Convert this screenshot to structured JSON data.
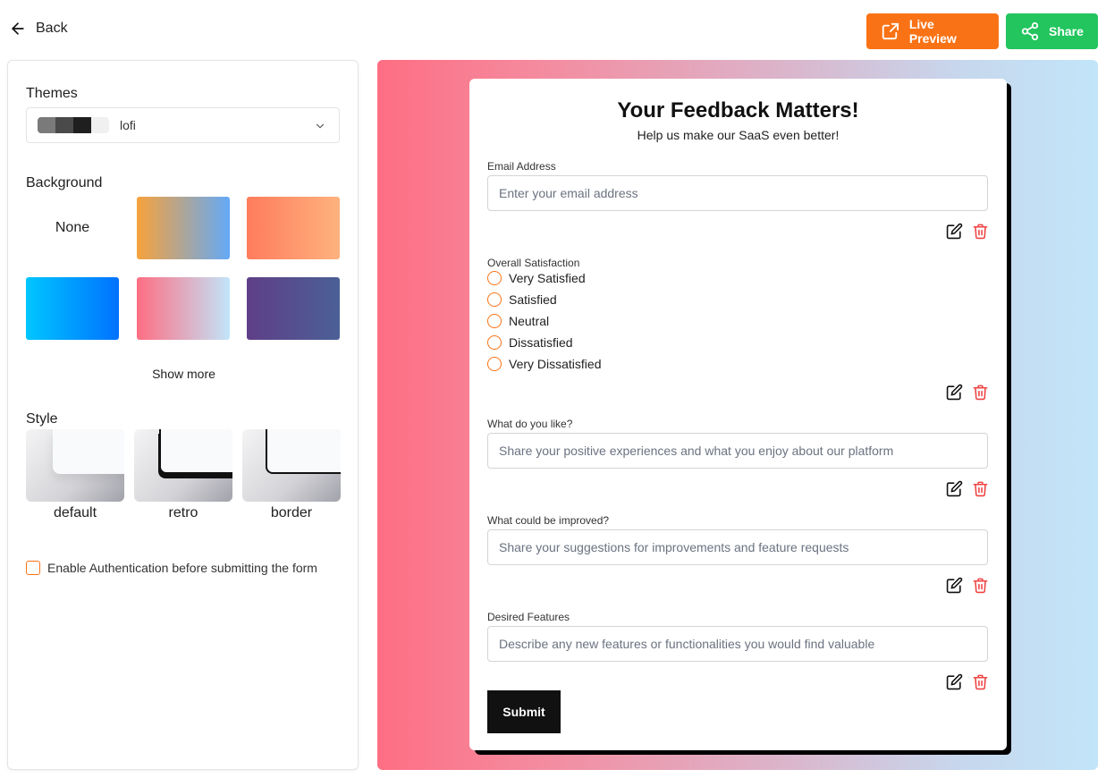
{
  "header": {
    "back_label": "Back",
    "live_preview_label": "Live Preview",
    "share_label": "Share",
    "colors": {
      "live_preview": "#f97316",
      "share": "#22c55e"
    }
  },
  "sidebar": {
    "themes_label": "Themes",
    "theme_selected": "lofi",
    "theme_swatches": [
      "#7a7a7a",
      "#4a4a4a",
      "#1f1f1f",
      "#f0f0f0"
    ],
    "background_label": "Background",
    "background_none_label": "None",
    "show_more_label": "Show more",
    "style_label": "Style",
    "styles": [
      "default",
      "retro",
      "border"
    ],
    "auth_label": "Enable Authentication before submitting the form"
  },
  "form": {
    "title": "Your Feedback Matters!",
    "subtitle": "Help us make our SaaS even better!",
    "email": {
      "label": "Email Address",
      "placeholder": "Enter your email address"
    },
    "satisfaction": {
      "label": "Overall Satisfaction",
      "options": [
        "Very Satisfied",
        "Satisfied",
        "Neutral",
        "Dissatisfied",
        "Very Dissatisfied"
      ]
    },
    "likes": {
      "label": "What do you like?",
      "placeholder": "Share your positive experiences and what you enjoy about our platform"
    },
    "improve": {
      "label": "What could be improved?",
      "placeholder": "Share your suggestions for improvements and feature requests"
    },
    "features": {
      "label": "Desired Features",
      "placeholder": "Describe any new features or functionalities you would find valuable"
    },
    "submit_label": "Submit"
  }
}
